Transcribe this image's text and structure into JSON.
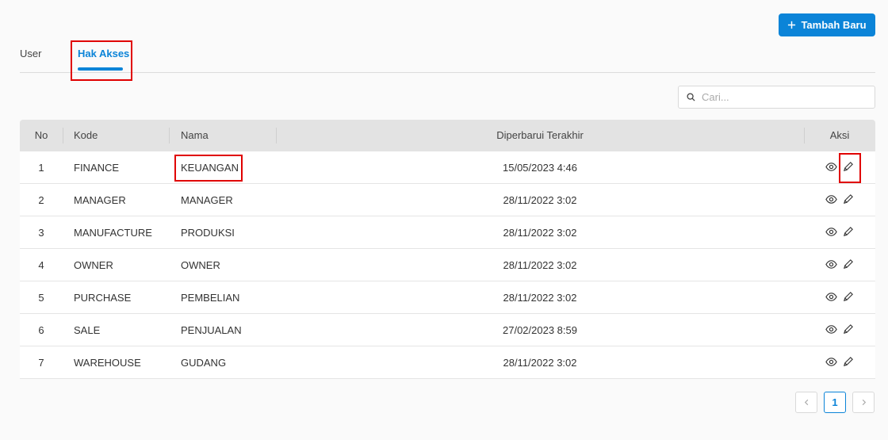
{
  "toolbar": {
    "add_label": "Tambah Baru",
    "add_icon": "plus-icon"
  },
  "tabs": [
    {
      "label": "User",
      "active": false
    },
    {
      "label": "Hak Akses",
      "active": true
    }
  ],
  "search": {
    "placeholder": "Cari...",
    "value": "",
    "icon": "search-icon"
  },
  "table": {
    "columns": [
      "No",
      "Kode",
      "Nama",
      "Diperbarui Terakhir",
      "Aksi"
    ],
    "rows": [
      {
        "no": "1",
        "kode": "FINANCE",
        "nama": "KEUANGAN",
        "updated": "15/05/2023 4:46"
      },
      {
        "no": "2",
        "kode": "MANAGER",
        "nama": "MANAGER",
        "updated": "28/11/2022 3:02"
      },
      {
        "no": "3",
        "kode": "MANUFACTURE",
        "nama": "PRODUKSI",
        "updated": "28/11/2022 3:02"
      },
      {
        "no": "4",
        "kode": "OWNER",
        "nama": "OWNER",
        "updated": "28/11/2022 3:02"
      },
      {
        "no": "5",
        "kode": "PURCHASE",
        "nama": "PEMBELIAN",
        "updated": "28/11/2022 3:02"
      },
      {
        "no": "6",
        "kode": "SALE",
        "nama": "PENJUALAN",
        "updated": "27/02/2023 8:59"
      },
      {
        "no": "7",
        "kode": "WAREHOUSE",
        "nama": "GUDANG",
        "updated": "28/11/2022 3:02"
      }
    ]
  },
  "pagination": {
    "current": "1"
  },
  "colors": {
    "accent": "#0b84d8",
    "highlight": "#e00000",
    "header_bg": "#e3e3e3"
  }
}
